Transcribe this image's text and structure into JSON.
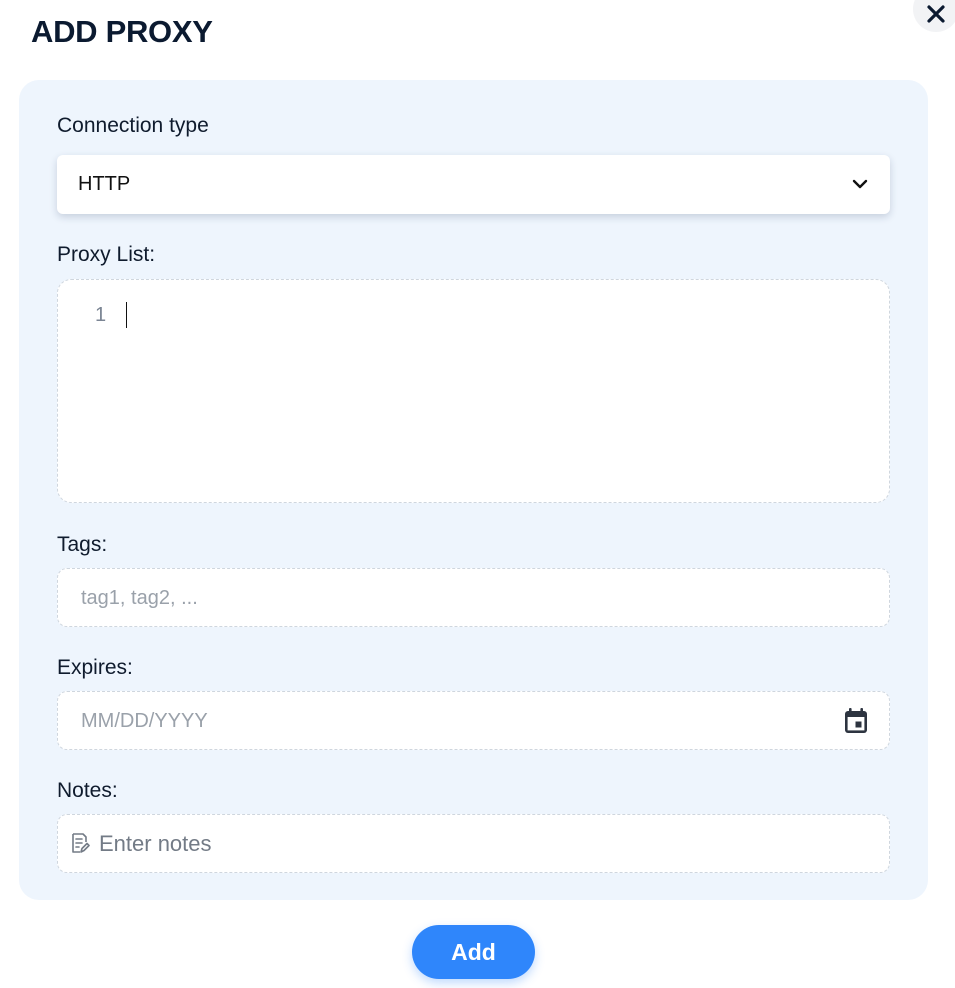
{
  "dialog": {
    "title": "ADD PROXY"
  },
  "connection_type": {
    "label": "Connection type",
    "selected": "HTTP"
  },
  "proxy_list": {
    "label": "Proxy List:",
    "line_numbers": [
      "1"
    ]
  },
  "tags": {
    "label": "Tags:",
    "placeholder": "tag1, tag2, ..."
  },
  "expires": {
    "label": "Expires:",
    "placeholder": "MM/DD/YYYY"
  },
  "notes": {
    "label": "Notes:",
    "placeholder": "Enter notes"
  },
  "actions": {
    "add_label": "Add"
  },
  "icons": {
    "close": "close-icon",
    "dropdown": "chevron-down-icon",
    "calendar": "calendar-icon",
    "notes": "notes-edit-icon"
  },
  "colors": {
    "accent": "#2f86fb",
    "panel_background": "#eef5fd",
    "title_text": "#0b1a30"
  }
}
